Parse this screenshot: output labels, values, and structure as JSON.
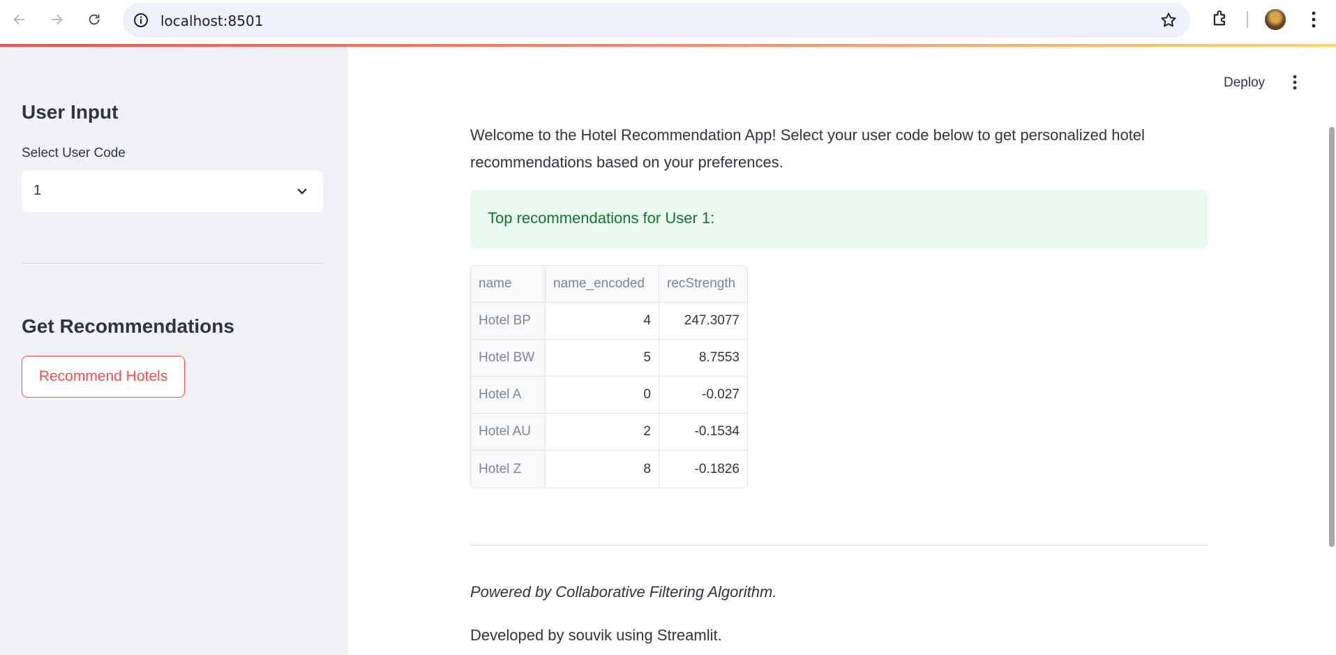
{
  "browser": {
    "url": "localhost:8501"
  },
  "header": {
    "deploy_label": "Deploy"
  },
  "sidebar": {
    "user_input_title": "User Input",
    "select_label": "Select User Code",
    "select_value": "1",
    "get_recs_title": "Get Recommendations",
    "recommend_button": "Recommend Hotels"
  },
  "main": {
    "intro": "Welcome to the Hotel Recommendation App! Select your user code below to get personalized hotel recommendations based on your preferences.",
    "success_message": "Top recommendations for User 1:",
    "table": {
      "columns": [
        "name",
        "name_encoded",
        "recStrength"
      ],
      "rows": [
        {
          "name": "Hotel BP",
          "name_encoded": "4",
          "recStrength": "247.3077"
        },
        {
          "name": "Hotel BW",
          "name_encoded": "5",
          "recStrength": "8.7553"
        },
        {
          "name": "Hotel A",
          "name_encoded": "0",
          "recStrength": "-0.027"
        },
        {
          "name": "Hotel AU",
          "name_encoded": "2",
          "recStrength": "-0.1534"
        },
        {
          "name": "Hotel Z",
          "name_encoded": "8",
          "recStrength": "-0.1826"
        }
      ]
    },
    "powered_by": "Powered by Collaborative Filtering Algorithm.",
    "developed_by": "Developed by souvik using Streamlit."
  },
  "colors": {
    "accent": "#ff4b4b",
    "success_bg": "#e8f9ee",
    "success_text": "#177233",
    "sidebar_bg": "#f0f2f6"
  }
}
